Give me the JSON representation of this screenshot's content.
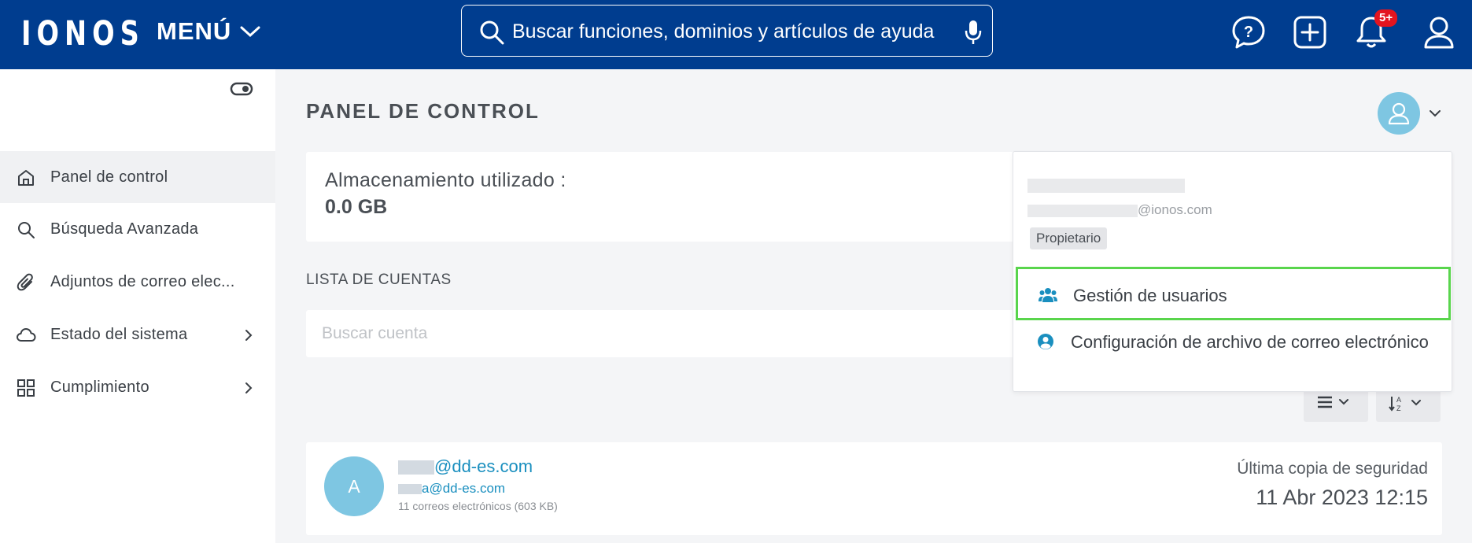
{
  "header": {
    "logo": "IONOS",
    "menu_label": "MENÚ",
    "search_placeholder": "Buscar funciones, dominios y artículos de ayuda",
    "notification_badge": "5+",
    "icons": [
      "help-icon",
      "add-icon",
      "bell-icon",
      "user-icon"
    ]
  },
  "sidebar": {
    "items": [
      {
        "label": "Panel de control",
        "icon": "home-icon",
        "active": true
      },
      {
        "label": "Búsqueda Avanzada",
        "icon": "search-icon"
      },
      {
        "label": "Adjuntos de correo elec...",
        "icon": "paperclip-icon"
      },
      {
        "label": "Estado del sistema",
        "icon": "cloud-icon",
        "has_submenu": true
      },
      {
        "label": "Cumplimiento",
        "icon": "grid-icon",
        "has_submenu": true
      }
    ]
  },
  "main": {
    "title": "PANEL DE CONTROL",
    "storage": {
      "label": "Almacenamiento utilizado :",
      "value": "0.0 GB"
    },
    "accounts_list_title": "LISTA DE CUENTAS",
    "account_search_placeholder": "Buscar cuenta",
    "accounts": [
      {
        "avatar_letter": "A",
        "email": "@dd-es.com",
        "secondary_email": "a@dd-es.com",
        "mail_count": "11 correos electrónicos (603 KB)",
        "backup_label": "Última copia de seguridad",
        "backup_date": "11 Abr 2023 12:15"
      }
    ]
  },
  "user_dropdown": {
    "email_suffix": "@ionos.com",
    "role": "Propietario",
    "items": [
      {
        "label": "Gestión de usuarios",
        "icon": "users-icon",
        "highlighted": true
      },
      {
        "label": "Configuración de archivo de correo electrónico",
        "icon": "user-circle-icon"
      }
    ]
  },
  "colors": {
    "header_bg": "#003d8f",
    "accent_avatar": "#7ec6e2",
    "link": "#1a8fbf",
    "highlight_border": "#59d54c",
    "badge": "#e4141f"
  }
}
